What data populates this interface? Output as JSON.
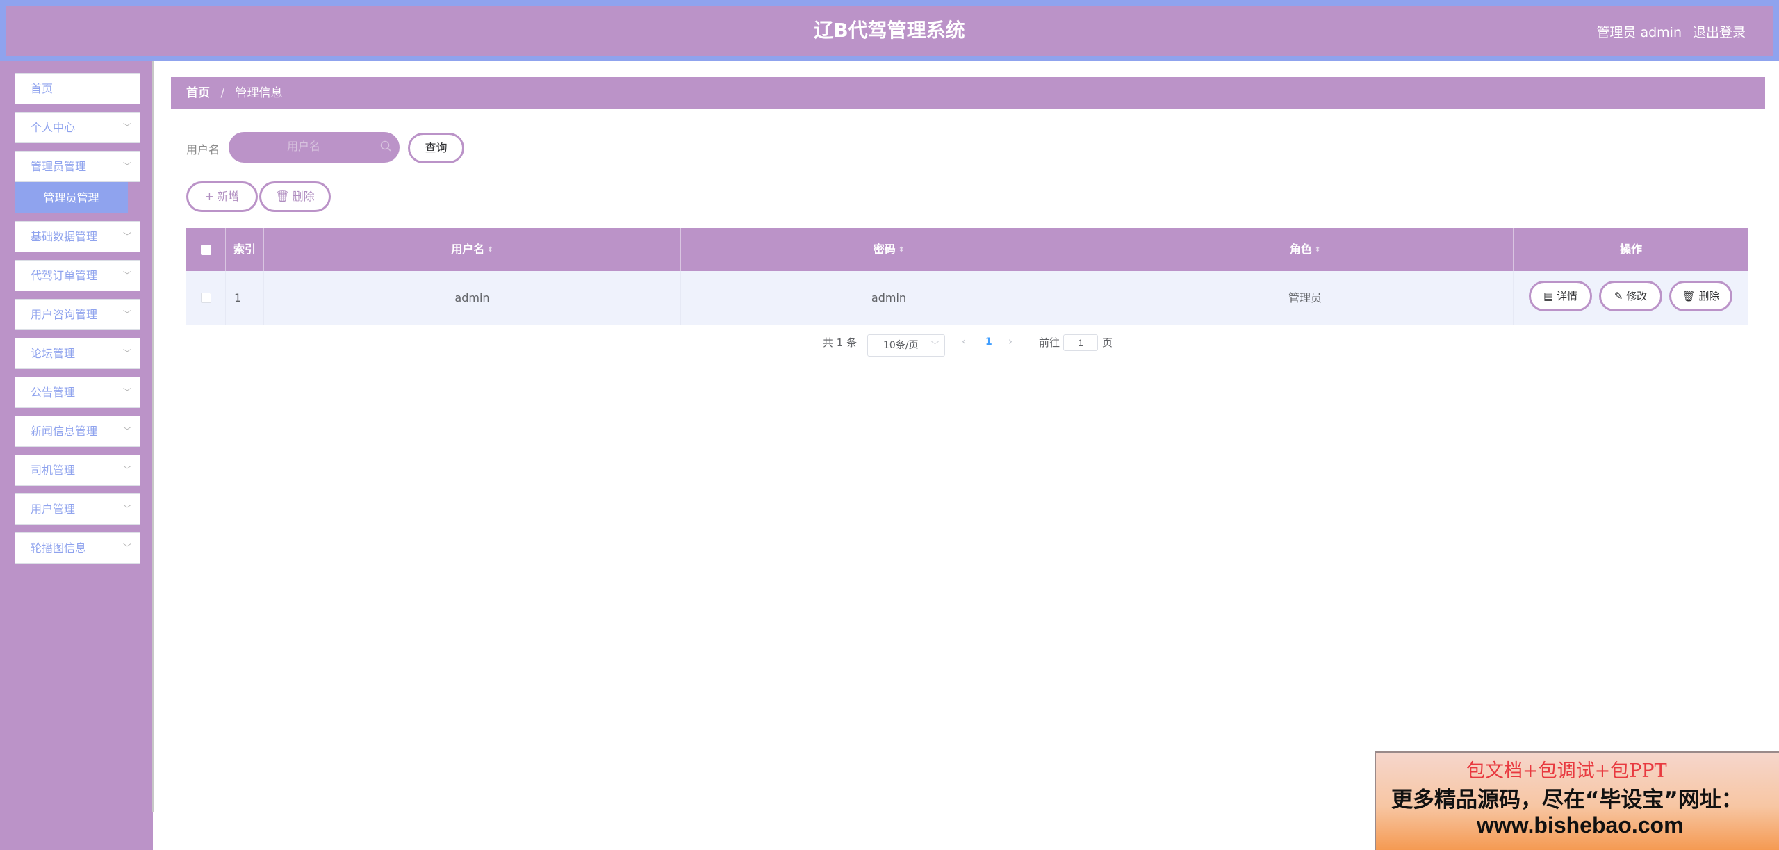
{
  "header": {
    "title": "辽B代驾管理系统",
    "user": "管理员 admin",
    "logout": "退出登录"
  },
  "sidebar": {
    "items": [
      {
        "label": "首页"
      },
      {
        "label": "个人中心"
      },
      {
        "label": "管理员管理"
      },
      {
        "label": "基础数据管理"
      },
      {
        "label": "代驾订单管理"
      },
      {
        "label": "用户咨询管理"
      },
      {
        "label": "论坛管理"
      },
      {
        "label": "公告管理"
      },
      {
        "label": "新闻信息管理"
      },
      {
        "label": "司机管理"
      },
      {
        "label": "用户管理"
      },
      {
        "label": "轮播图信息"
      }
    ],
    "submenu": {
      "label": "管理员管理"
    }
  },
  "breadcrumb": {
    "home": "首页",
    "separator": "/",
    "current": "管理信息"
  },
  "search": {
    "label": "用户名",
    "placeholder": "用户名",
    "query_button": "查询"
  },
  "actions": {
    "add": "新增",
    "delete": "删除"
  },
  "table": {
    "headers": [
      "索引",
      "用户名",
      "密码",
      "角色",
      "操作"
    ],
    "rows": [
      {
        "index": "1",
        "username": "admin",
        "password": "admin",
        "role": "管理员"
      }
    ],
    "row_actions": {
      "detail": "详情",
      "edit": "修改",
      "delete": "删除"
    }
  },
  "pagination": {
    "total": "共 1 条",
    "page_size": "10条/页",
    "current_page": "1",
    "goto_label": "前往",
    "goto_value": "1",
    "page_suffix": "页"
  },
  "watermark": {
    "line1": "包文档+包调试+包PPT",
    "line2": "更多精品源码，尽在“毕设宝”网址：",
    "line3": "www.bishebao.com"
  },
  "colors": {
    "primary": "#bb93c8",
    "accent": "#8fa3ee"
  }
}
